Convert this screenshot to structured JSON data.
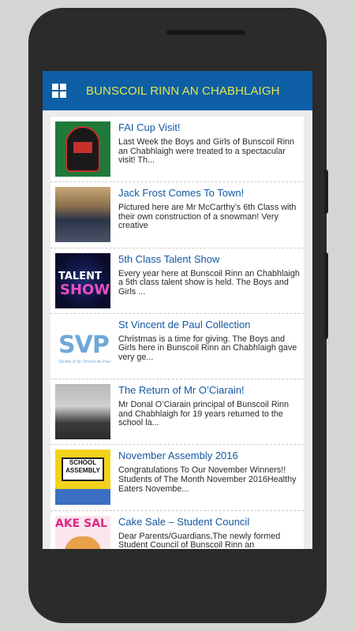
{
  "app": {
    "title": "BUNSCOIL RINN AN CHABHLAIGH",
    "menu_icon": "grid-menu-icon"
  },
  "colors": {
    "appbar": "#0e5fa6",
    "title_text": "#e1e64a",
    "post_title": "#1459a2"
  },
  "posts": [
    {
      "title": "FAI Cup Visit!",
      "excerpt": "Last Week the Boys and Girls of Bunscoil Rinn an Chabhlaigh were treated to a spectacular visit! Th...",
      "thumb_text": "CORK CITY"
    },
    {
      "title": "Jack Frost Comes To Town!",
      "excerpt": "Pictured here are Mr McCarthy’s 6th Class with their own construction of a snowman! Very creative"
    },
    {
      "title": "5th Class Talent Show",
      "excerpt": "Every year here at Bunscoil Rinn an Chabhlaigh a 5th class talent show is held. The Boys and Girls ...",
      "thumb_text_1": "TALENT",
      "thumb_text_2": "SHOW"
    },
    {
      "title": "St Vincent de Paul Collection",
      "excerpt": "Christmas is a time for giving. The Boys and Girls here in Bunscoil Rinn an Chabhlaigh gave very ge...",
      "thumb_text_1": "SVP",
      "thumb_text_2": "Society of St. Vincent de Paul"
    },
    {
      "title": "The Return of Mr O’Ciarain!",
      "excerpt": "Mr Donal O’Ciarain principal of Bunscoil Rinn and Chabhlaigh for 19 years returned to the school la..."
    },
    {
      "title": "November Assembly 2016",
      "excerpt": "Congratulations To Our November Winners!! Students of The Month November 2016Healthy Eaters Novembe...",
      "thumb_text": "SCHOOL ASSEMBLY"
    },
    {
      "title": "Cake Sale – Student Council",
      "excerpt": "Dear Parents/Guardians,The newly formed Student Council of Bunscoil Rinn an",
      "thumb_text": "AKE SAL"
    }
  ]
}
